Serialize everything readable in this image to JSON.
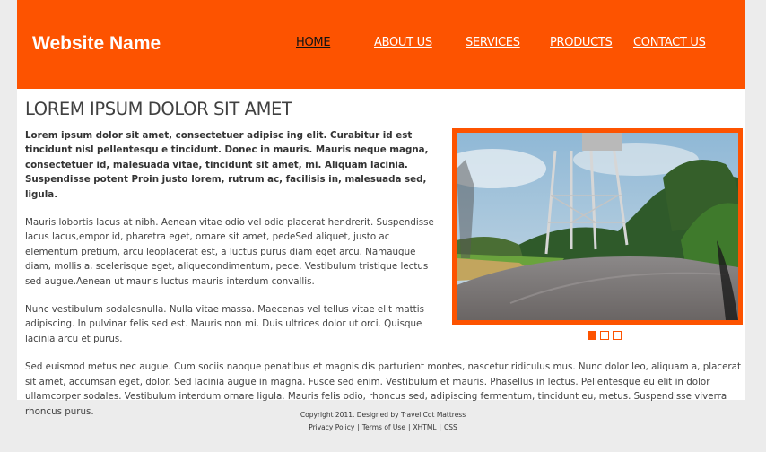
{
  "header": {
    "site_name": "Website Name",
    "nav": [
      {
        "label": "HOME",
        "active": true
      },
      {
        "label": "ABOUT US",
        "active": false
      },
      {
        "label": "SERVICES",
        "active": false
      },
      {
        "label": "PRODUCTS",
        "active": false
      },
      {
        "label": "CONTACT US",
        "active": false
      }
    ]
  },
  "main": {
    "heading": "LOREM IPSUM DOLOR SIT AMET",
    "lead": "Lorem ipsum dolor sit amet, consectetuer adipisc ing elit. Curabitur id est tincidunt nisl pellentesqu e tincidunt. Donec in mauris. Mauris neque magna, consectetuer id, malesuada vitae, tincidunt sit amet, mi. Aliquam lacinia. Suspendisse potent Proin justo lorem, rutrum ac, facilisis in, malesuada sed, ligula.",
    "paragraphs": [
      "Mauris lobortis lacus at nibh. Aenean vitae odio vel odio placerat hendrerit. Suspendisse lacus lacus,empor id, pharetra eget, ornare sit amet, pedeSed aliquet, justo ac elementum pretium, arcu leoplacerat est, a luctus purus diam eget arcu. Namaugue diam, mollis a, scelerisque eget, aliquecondimentum, pede. Vestibulum tristique lectus sed augue.Aenean ut mauris luctus mauris interdum convallis.",
      "Nunc vestibulum sodalesnulla. Nulla vitae massa. Maecenas vel tellus vitae elit mattis adipiscing. In pulvinar felis sed est. Mauris non mi. Duis ultrices dolor ut orci. Quisque lacinia arcu et purus.",
      "Sed euismod metus nec augue. Cum sociis naoque penatibus et magnis dis parturient montes, nascetur ridiculus mus. Nunc dolor leo, aliquam a, placerat sit amet, accumsan eget, dolor. Sed lacinia augue in magna. Fusce sed enim. Vestibulum et mauris. Phasellus in lectus. Pellentesque eu elit in dolor ullamcorper sodales. Vestibulum interdum ornare ligula. Mauris felis odio, rhoncus sed, adipiscing fermentum, tincidunt eu, metus. Suspendisse viverra rhoncus purus."
    ]
  },
  "slider": {
    "image_icon": "road-photo",
    "slide_count": 3,
    "active_slide": 1
  },
  "footer": {
    "copyright": "Copyright 2011. Designed by Travel Cot Mattress",
    "links": [
      "Privacy Policy",
      "Terms of Use",
      "XHTML",
      "CSS"
    ],
    "separator": "|"
  },
  "colors": {
    "accent": "#fd5300",
    "background": "#ececec",
    "content_bg": "#ffffff",
    "active_nav": "#111111"
  }
}
